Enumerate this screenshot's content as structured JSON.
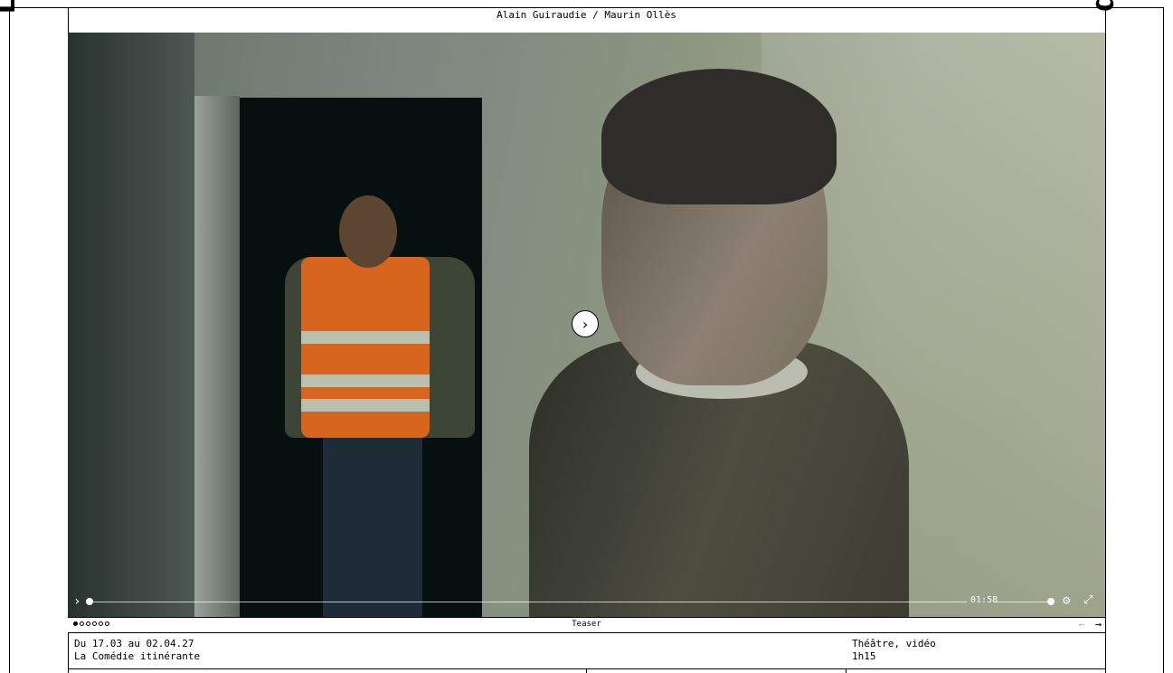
{
  "brand": {
    "left_text": "La Comédie",
    "right_text": "de Valence"
  },
  "show": {
    "credit": "Alain Guiraudie / Maurin Ollès"
  },
  "player": {
    "time": "01:58",
    "play_symbol": "›",
    "small_play_symbol": "›",
    "gear_symbol": "⚙",
    "fullscreen_symbol": "⤢"
  },
  "carousel": {
    "label": "Teaser",
    "slide_count": 6,
    "active_index": 0,
    "prev_symbol": "←",
    "next_symbol": "→"
  },
  "info": {
    "dates": "Du 17.03 au 02.04.27",
    "venue": "La Comédie itinérante",
    "genre": "Théâtre, vidéo",
    "duration": "1h15"
  },
  "colors": {
    "accent": "#000000",
    "background": "#ffffff"
  }
}
